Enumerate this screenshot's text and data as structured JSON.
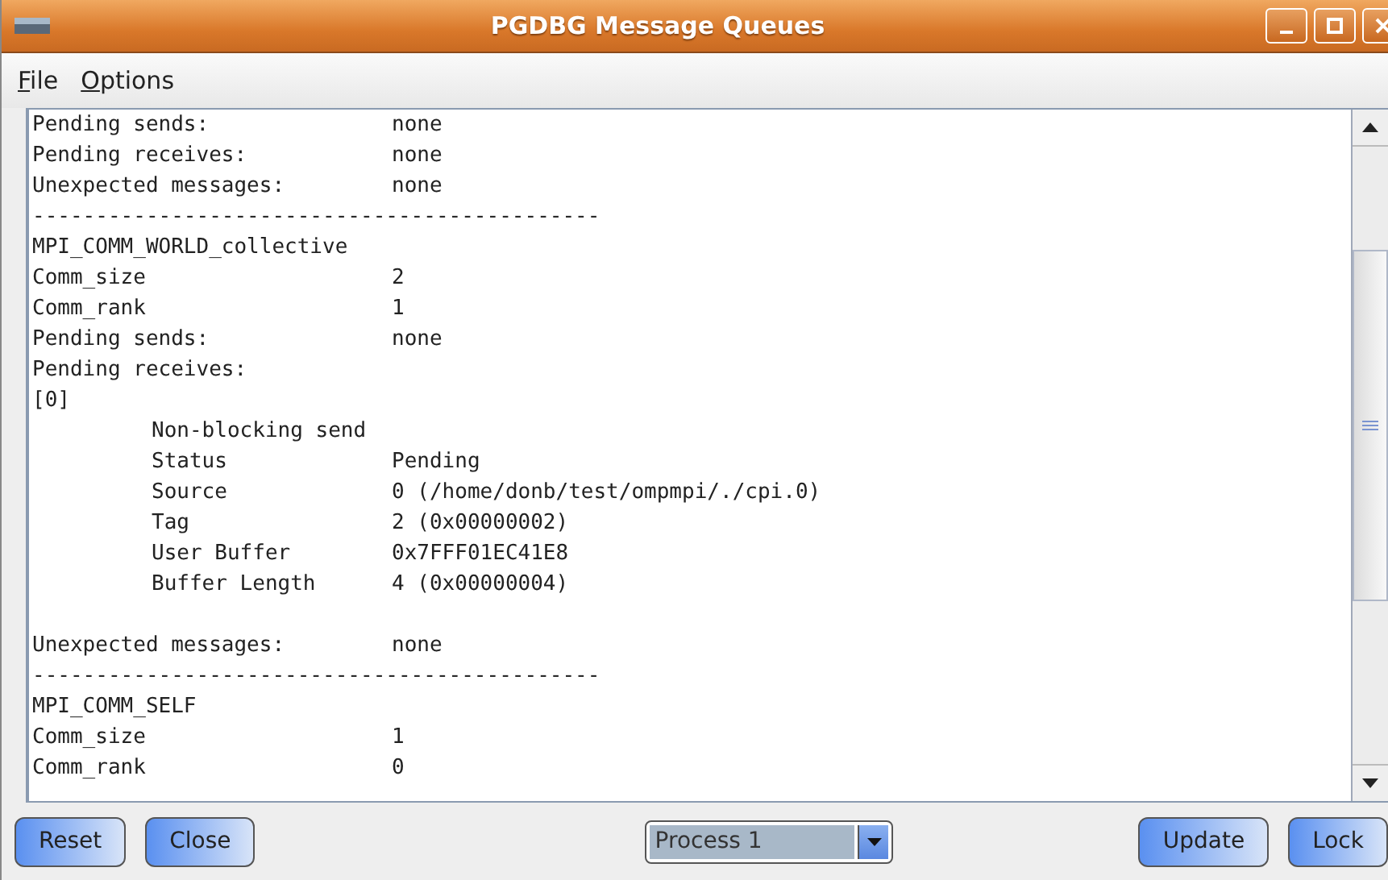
{
  "window": {
    "title": "PGDBG Message Queues"
  },
  "menu": [
    {
      "label": "File"
    },
    {
      "label": "Options"
    }
  ],
  "lines": [
    {
      "kind": "pair",
      "label": "Pending sends:",
      "value": "none"
    },
    {
      "kind": "pair",
      "label": "Pending receives:",
      "value": "none"
    },
    {
      "kind": "pair",
      "label": "Unexpected messages:",
      "value": "none"
    },
    {
      "kind": "text",
      "text": "---------------------------------------------"
    },
    {
      "kind": "text",
      "text": "MPI_COMM_WORLD_collective"
    },
    {
      "kind": "pair",
      "label": "Comm_size",
      "value": "2"
    },
    {
      "kind": "pair",
      "label": "Comm_rank",
      "value": "1"
    },
    {
      "kind": "pair",
      "label": "Pending sends:",
      "value": "none"
    },
    {
      "kind": "text",
      "text": "Pending receives:"
    },
    {
      "kind": "text",
      "text": "[0]",
      "children": [
        {
          "kind": "text",
          "text": "Non-blocking send"
        },
        {
          "kind": "pair",
          "label": "Status",
          "value": "Pending"
        },
        {
          "kind": "pair",
          "label": "Source",
          "value": "0 (/home/donb/test/ompmpi/./cpi.0)"
        },
        {
          "kind": "pair",
          "label": "Tag",
          "value": "2 (0x00000002)"
        },
        {
          "kind": "pair",
          "label": "User Buffer",
          "value": "0x7FFF01EC41E8"
        },
        {
          "kind": "pair",
          "label": "Buffer Length",
          "value": "4 (0x00000004)"
        }
      ]
    },
    {
      "kind": "blank"
    },
    {
      "kind": "pair",
      "label": "Unexpected messages:",
      "value": "none"
    },
    {
      "kind": "text",
      "text": "---------------------------------------------"
    },
    {
      "kind": "text",
      "text": "MPI_COMM_SELF"
    },
    {
      "kind": "pair",
      "label": "Comm_size",
      "value": "1"
    },
    {
      "kind": "pair",
      "label": "Comm_rank",
      "value": "0"
    }
  ],
  "buttons_left": [
    {
      "label": "Reset"
    },
    {
      "label": "Close"
    }
  ],
  "process_select": {
    "value": "Process 1"
  },
  "buttons_right": [
    {
      "label": "Update"
    },
    {
      "label": "Lock"
    }
  ]
}
